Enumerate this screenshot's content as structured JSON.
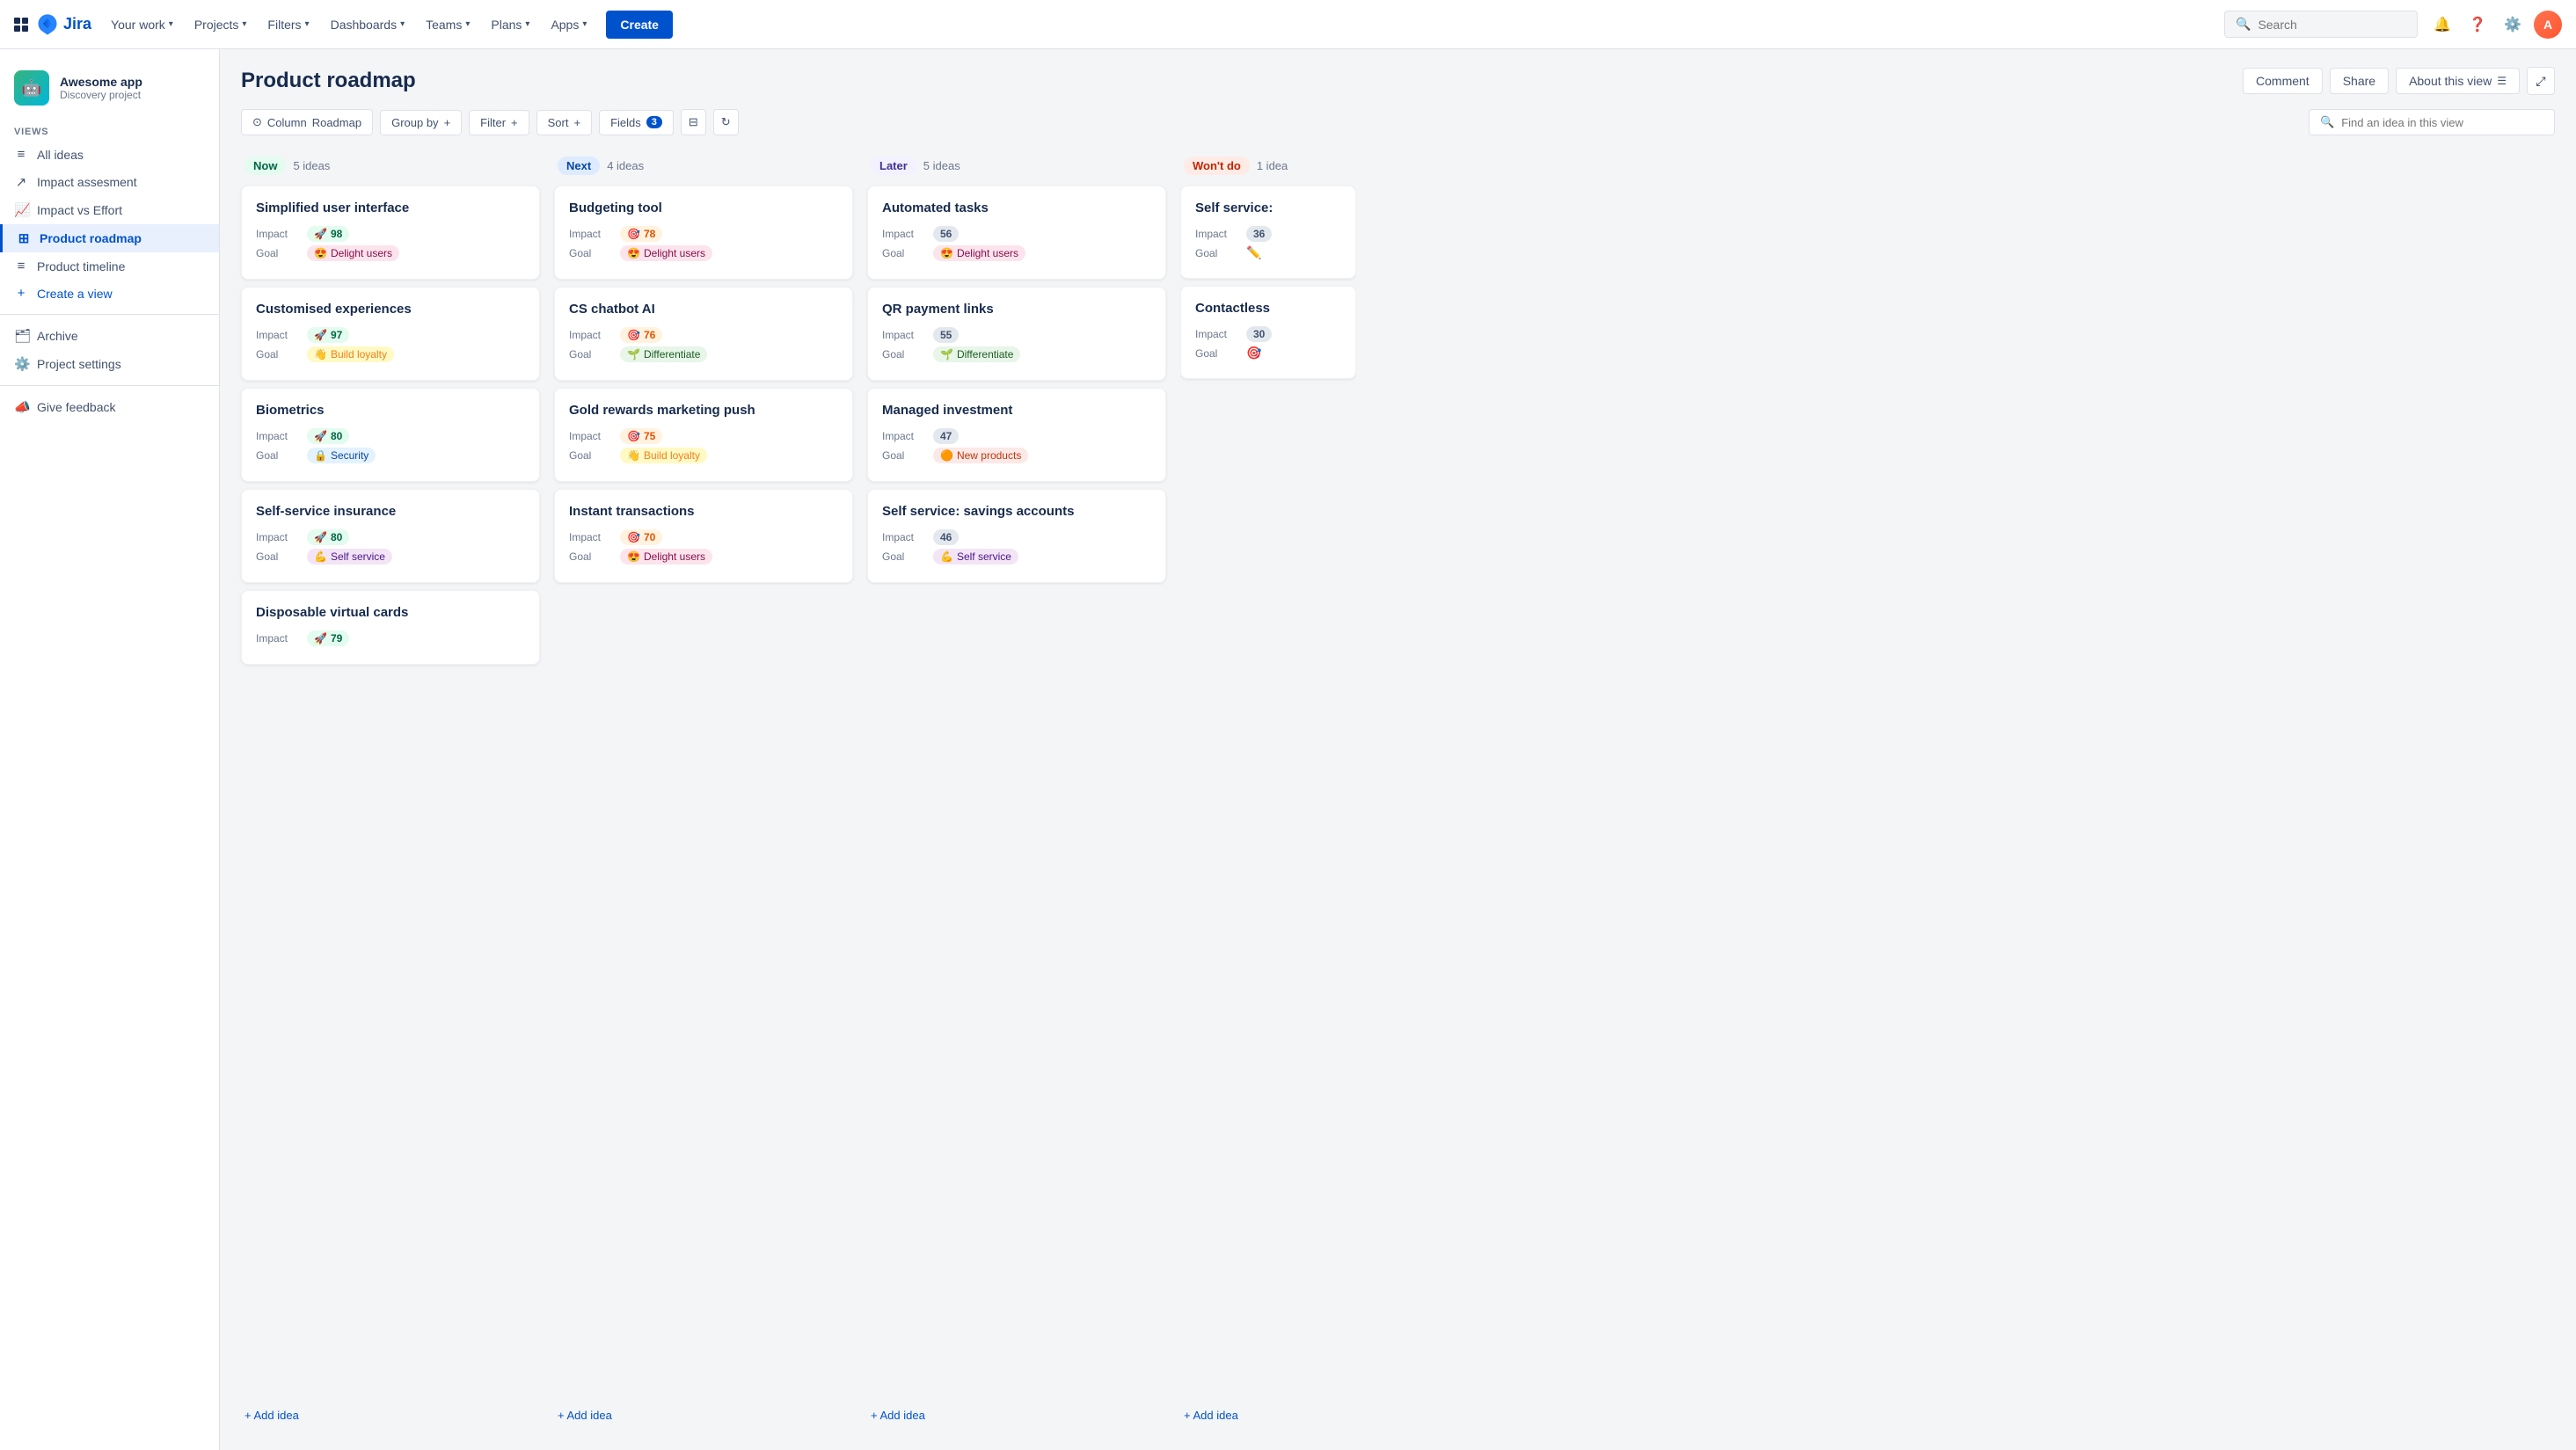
{
  "topnav": {
    "logo_text": "Jira",
    "nav_items": [
      {
        "label": "Your work",
        "has_dropdown": true
      },
      {
        "label": "Projects",
        "has_dropdown": true
      },
      {
        "label": "Filters",
        "has_dropdown": true
      },
      {
        "label": "Dashboards",
        "has_dropdown": true
      },
      {
        "label": "Teams",
        "has_dropdown": true
      },
      {
        "label": "Plans",
        "has_dropdown": true
      },
      {
        "label": "Apps",
        "has_dropdown": true
      }
    ],
    "create_label": "Create",
    "search_placeholder": "Search"
  },
  "sidebar": {
    "project_name": "Awesome app",
    "project_sub": "Discovery project",
    "views_label": "VIEWS",
    "items": [
      {
        "label": "All ideas",
        "icon": "≡",
        "active": false
      },
      {
        "label": "Impact assesment",
        "icon": "↗",
        "active": false
      },
      {
        "label": "Impact vs Effort",
        "icon": "📊",
        "active": false
      },
      {
        "label": "Product roadmap",
        "icon": "⊞",
        "active": true
      },
      {
        "label": "Product timeline",
        "icon": "≡",
        "active": false
      },
      {
        "label": "Create a view",
        "icon": "+",
        "active": false,
        "is_create": true
      }
    ],
    "archive_label": "Archive",
    "settings_label": "Project settings",
    "feedback_label": "Give feedback"
  },
  "page": {
    "title": "Product roadmap",
    "header_btns": [
      {
        "label": "Comment"
      },
      {
        "label": "Share"
      },
      {
        "label": "About this view"
      }
    ],
    "toolbar": {
      "column_label": "Column",
      "column_value": "Roadmap",
      "groupby_label": "Group by",
      "filter_label": "Filter",
      "sort_label": "Sort",
      "fields_label": "Fields",
      "fields_count": "3"
    },
    "search_placeholder": "Find an idea in this view"
  },
  "board": {
    "columns": [
      {
        "id": "now",
        "tag_label": "Now",
        "tag_class": "tag-now",
        "count": "5 ideas",
        "cards": [
          {
            "title": "Simplified user interface",
            "impact_value": "98",
            "impact_icon": "🚀",
            "impact_class": "",
            "goal_icon": "😍",
            "goal_label": "Delight users",
            "goal_class": "goal-delight"
          },
          {
            "title": "Customised experiences",
            "impact_value": "97",
            "impact_icon": "🚀",
            "impact_class": "",
            "goal_icon": "👋",
            "goal_label": "Build loyalty",
            "goal_class": "goal-loyalty"
          },
          {
            "title": "Biometrics",
            "impact_value": "80",
            "impact_icon": "🚀",
            "impact_class": "",
            "goal_icon": "🔒",
            "goal_label": "Security",
            "goal_class": "goal-security"
          },
          {
            "title": "Self-service insurance",
            "impact_value": "80",
            "impact_icon": "🚀",
            "impact_class": "",
            "goal_icon": "💪",
            "goal_label": "Self service",
            "goal_class": "goal-service"
          },
          {
            "title": "Disposable virtual cards",
            "impact_value": "79",
            "impact_icon": "🚀",
            "impact_class": "",
            "goal_icon": "",
            "goal_label": "",
            "goal_class": ""
          }
        ],
        "add_label": "+ Add idea"
      },
      {
        "id": "next",
        "tag_label": "Next",
        "tag_class": "tag-next",
        "count": "4 ideas",
        "cards": [
          {
            "title": "Budgeting tool",
            "impact_value": "78",
            "impact_icon": "🎯",
            "impact_class": "orange",
            "goal_icon": "😍",
            "goal_label": "Delight users",
            "goal_class": "goal-delight"
          },
          {
            "title": "CS chatbot AI",
            "impact_value": "76",
            "impact_icon": "🎯",
            "impact_class": "orange",
            "goal_icon": "🌱",
            "goal_label": "Differentiate",
            "goal_class": "goal-differentiate"
          },
          {
            "title": "Gold rewards marketing push",
            "impact_value": "75",
            "impact_icon": "🎯",
            "impact_class": "orange",
            "goal_icon": "👋",
            "goal_label": "Build loyalty",
            "goal_class": "goal-loyalty"
          },
          {
            "title": "Instant transactions",
            "impact_value": "70",
            "impact_icon": "🎯",
            "impact_class": "orange",
            "goal_icon": "😍",
            "goal_label": "Delight users",
            "goal_class": "goal-delight"
          }
        ],
        "add_label": "+ Add idea"
      },
      {
        "id": "later",
        "tag_label": "Later",
        "tag_class": "tag-later",
        "count": "5 ideas",
        "cards": [
          {
            "title": "Automated tasks",
            "impact_value": "56",
            "impact_icon": "",
            "impact_class": "",
            "goal_icon": "😍",
            "goal_label": "Delight users",
            "goal_class": "goal-delight"
          },
          {
            "title": "QR payment links",
            "impact_value": "55",
            "impact_icon": "",
            "impact_class": "",
            "goal_icon": "🌱",
            "goal_label": "Differentiate",
            "goal_class": "goal-differentiate"
          },
          {
            "title": "Managed investment",
            "impact_value": "47",
            "impact_icon": "",
            "impact_class": "",
            "goal_icon": "🟠",
            "goal_label": "New products",
            "goal_class": "goal-newproducts"
          },
          {
            "title": "Self service: savings accounts",
            "impact_value": "46",
            "impact_icon": "",
            "impact_class": "",
            "goal_icon": "💪",
            "goal_label": "Self service",
            "goal_class": "goal-service"
          }
        ],
        "add_label": "+ Add idea"
      },
      {
        "id": "wontdo",
        "tag_label": "Won't do",
        "tag_class": "tag-wontdo",
        "count": "1 idea",
        "cards": [
          {
            "title": "Self service:",
            "impact_value": "36",
            "impact_icon": "",
            "impact_class": "",
            "goal_icon": "",
            "goal_label": "",
            "goal_class": ""
          },
          {
            "title": "Contactless",
            "impact_value": "30",
            "impact_icon": "",
            "impact_class": "",
            "goal_icon": "",
            "goal_label": "",
            "goal_class": ""
          }
        ],
        "add_label": "+ Add idea"
      }
    ]
  },
  "labels": {
    "impact": "Impact",
    "goal": "Goal"
  }
}
